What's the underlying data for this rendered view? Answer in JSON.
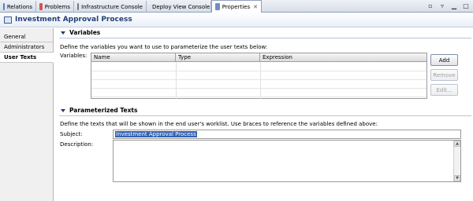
{
  "tabs": [
    {
      "label": "Relations",
      "icon": "relations-icon",
      "color": "#5a7fbf"
    },
    {
      "label": "Problems",
      "icon": "problems-icon",
      "color": "#d9534f"
    },
    {
      "label": "Infrastructure Console",
      "icon": "console-icon",
      "color": "#7a7a7a"
    },
    {
      "label": "Deploy View Console",
      "icon": "deploy-gear-icon",
      "color": "#444444"
    },
    {
      "label": "Properties",
      "icon": "properties-icon",
      "color": "#6f8fc4",
      "close": "✕"
    }
  ],
  "title": "Investment Approval Process",
  "sidebar": {
    "items": [
      {
        "label": "General"
      },
      {
        "label": "Administrators"
      },
      {
        "label": "User Texts"
      }
    ]
  },
  "variables": {
    "heading": "Variables",
    "description": "Define the variables you want to use to parameterize the user texts below:",
    "field_label": "Variables:",
    "columns": [
      "Name",
      "Type",
      "Expression"
    ],
    "add_label": "Add",
    "remove_label": "Remove",
    "edit_label": "Edit..."
  },
  "texts": {
    "heading": "Parameterized Texts",
    "description": "Define the texts that will be shown in the end user's worklist. Use braces to reference the variables defined above:",
    "subject_label": "Subject:",
    "subject_value": "Investment Approval Process",
    "description_label": "Description:"
  },
  "colors": {
    "accent": "#22407a",
    "selection": "#3264b4"
  }
}
